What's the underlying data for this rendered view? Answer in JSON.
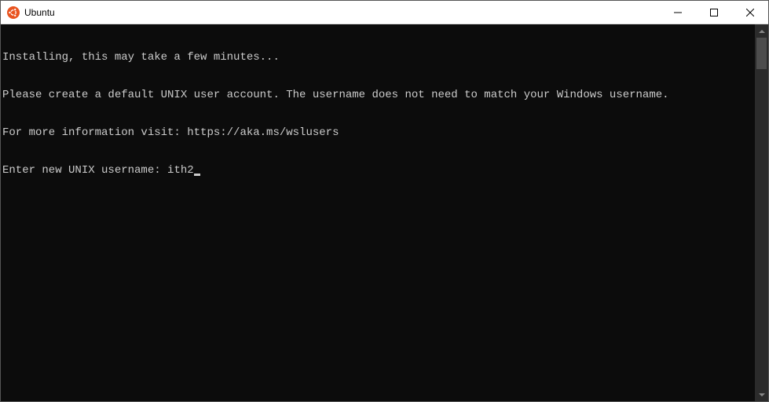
{
  "window": {
    "title": "Ubuntu",
    "icon_bg": "#E95420",
    "icon_fg": "#ffffff"
  },
  "terminal": {
    "lines": [
      "Installing, this may take a few minutes...",
      "Please create a default UNIX user account. The username does not need to match your Windows username.",
      "For more information visit: https://aka.ms/wslusers"
    ],
    "prompt": "Enter new UNIX username: ",
    "input_value": "ith2"
  }
}
